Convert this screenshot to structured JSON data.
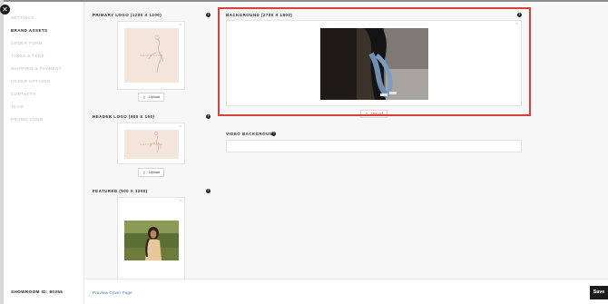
{
  "sidebar": {
    "items": [
      {
        "label": "SETTINGS",
        "active": false
      },
      {
        "label": "BRAND ASSETS",
        "active": true
      },
      {
        "label": "ORDER FORM",
        "active": false
      },
      {
        "label": "TAXES & FEES",
        "active": false
      },
      {
        "label": "SHIPPING & PAYMENT",
        "active": false
      },
      {
        "label": "ORDER OPTIONS",
        "active": false
      },
      {
        "label": "CONTACTS",
        "active": false
      },
      {
        "label": "TEAM",
        "active": false
      },
      {
        "label": "PROMO CODE",
        "active": false
      }
    ],
    "showroom_id": "SHOWROOM ID: 80356"
  },
  "sections": {
    "primary_logo": {
      "title": "PRIMARY LOGO (1200 X 1200)",
      "logo_text": "SHAUN FAME",
      "upload_label": "Upload"
    },
    "header_logo": {
      "title": "HEADER LOGO (900 X 150)",
      "logo_text": "SHAUN FAME",
      "upload_label": "Upload"
    },
    "featured": {
      "title": "FEATURED (900 X 1200)"
    },
    "background": {
      "title": "BACKGROUND (2700 X 1800)",
      "upload_label": "Upload"
    },
    "video_background": {
      "title": "VIDEO BACKGROUND",
      "value": ""
    }
  },
  "footer": {
    "preview_link": "Preview Cover Page",
    "save_label": "Save"
  },
  "colors": {
    "highlight": "#d9403a",
    "logo_bg": "#f4e5da",
    "link": "#4a7fb0"
  }
}
